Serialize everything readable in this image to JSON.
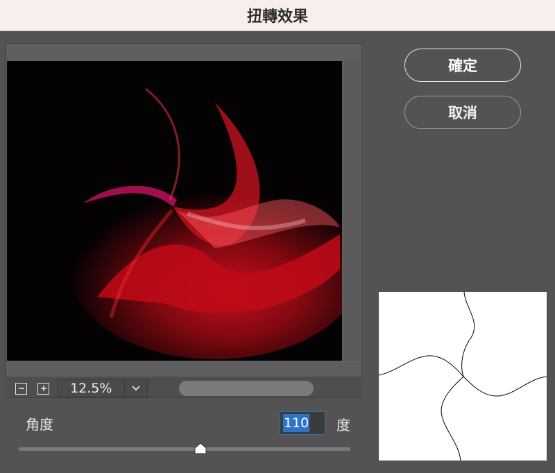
{
  "window": {
    "title": "扭轉效果"
  },
  "buttons": {
    "ok": "確定",
    "cancel": "取消"
  },
  "zoom": {
    "value": "12.5%",
    "minus_icon": "minus-icon",
    "plus_icon": "plus-icon",
    "dropdown_icon": "chevron-down-icon"
  },
  "angle": {
    "label": "角度",
    "value": "110",
    "unit": "度",
    "slider_fraction": 0.55
  },
  "colors": {
    "background": "#535353",
    "titlebar": "#f8eeec",
    "accent": "#2d73c7",
    "swirl_red": "#e0101c"
  }
}
